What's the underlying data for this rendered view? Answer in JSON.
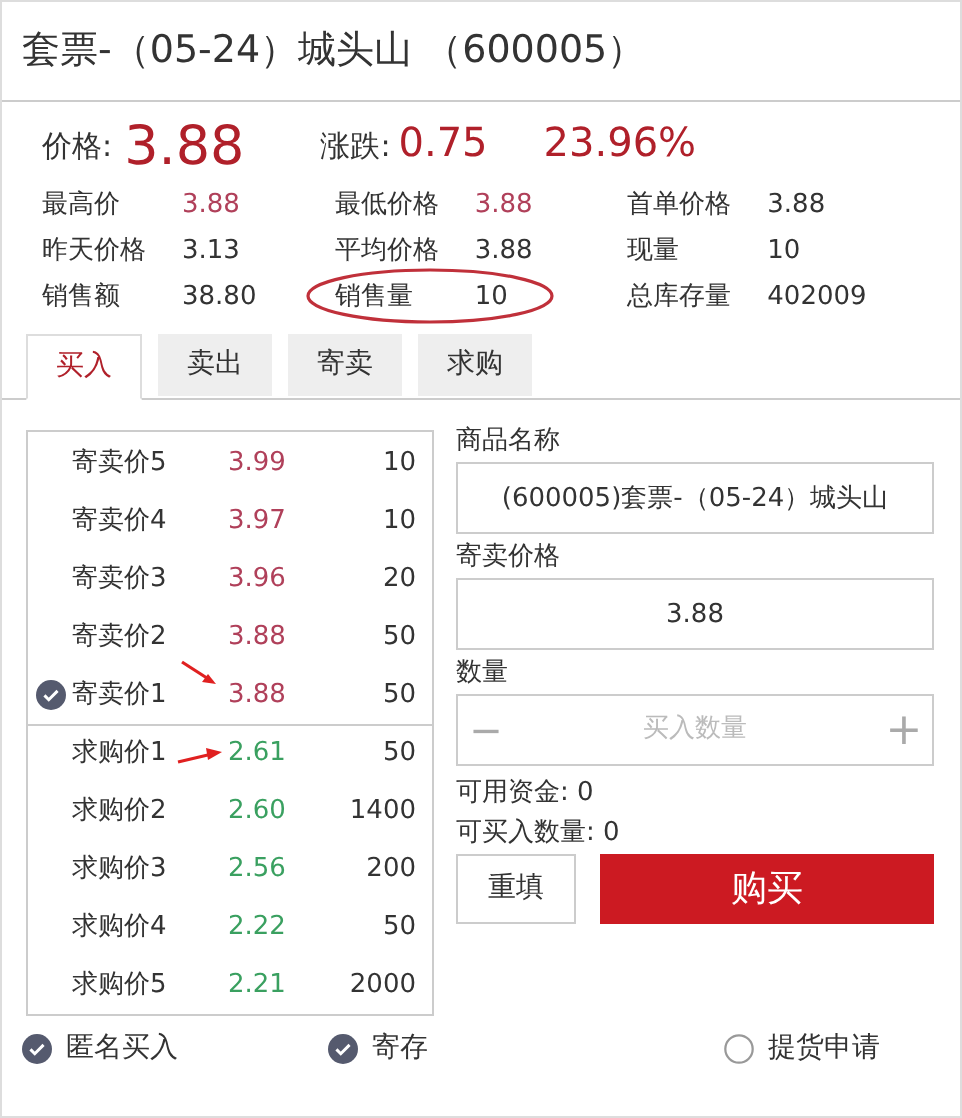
{
  "title": "套票-（05-24）城头山 （600005）",
  "price": {
    "label": "价格:",
    "value": "3.88"
  },
  "change": {
    "label": "涨跌:",
    "value": "0.75",
    "percent": "23.96%"
  },
  "stats": [
    {
      "label": "最高价",
      "value": "3.88",
      "kind": "price",
      "circled": false
    },
    {
      "label": "最低价格",
      "value": "3.88",
      "kind": "price",
      "circled": false
    },
    {
      "label": "首单价格",
      "value": "3.88",
      "kind": "plain",
      "circled": false
    },
    {
      "label": "昨天价格",
      "value": "3.13",
      "kind": "plain",
      "circled": false
    },
    {
      "label": "平均价格",
      "value": "3.88",
      "kind": "plain",
      "circled": false
    },
    {
      "label": "现量",
      "value": "10",
      "kind": "plain",
      "circled": false
    },
    {
      "label": "销售额",
      "value": "38.80",
      "kind": "plain",
      "circled": false
    },
    {
      "label": "销售量",
      "value": "10",
      "kind": "plain",
      "circled": true
    },
    {
      "label": "总库存量",
      "value": "402009",
      "kind": "plain",
      "circled": false
    }
  ],
  "tabs": [
    {
      "label": "买入",
      "selected": true
    },
    {
      "label": "卖出",
      "selected": false
    },
    {
      "label": "寄卖",
      "selected": false
    },
    {
      "label": "求购",
      "selected": false
    }
  ],
  "order_book": [
    {
      "label": "寄卖价5",
      "price": "3.99",
      "qty": "10",
      "kind": "sell",
      "selected": false,
      "arrow": false
    },
    {
      "label": "寄卖价4",
      "price": "3.97",
      "qty": "10",
      "kind": "sell",
      "selected": false,
      "arrow": false
    },
    {
      "label": "寄卖价3",
      "price": "3.96",
      "qty": "20",
      "kind": "sell",
      "selected": false,
      "arrow": false
    },
    {
      "label": "寄卖价2",
      "price": "3.88",
      "qty": "50",
      "kind": "sell",
      "selected": false,
      "arrow": false
    },
    {
      "label": "寄卖价1",
      "price": "3.88",
      "qty": "50",
      "kind": "sell",
      "selected": true,
      "arrow": true
    },
    {
      "label": "求购价1",
      "price": "2.61",
      "qty": "50",
      "kind": "buy",
      "selected": false,
      "arrow": true
    },
    {
      "label": "求购价2",
      "price": "2.60",
      "qty": "1400",
      "kind": "buy",
      "selected": false,
      "arrow": false
    },
    {
      "label": "求购价3",
      "price": "2.56",
      "qty": "200",
      "kind": "buy",
      "selected": false,
      "arrow": false
    },
    {
      "label": "求购价4",
      "price": "2.22",
      "qty": "50",
      "kind": "buy",
      "selected": false,
      "arrow": false
    },
    {
      "label": "求购价5",
      "price": "2.21",
      "qty": "2000",
      "kind": "buy",
      "selected": false,
      "arrow": false
    }
  ],
  "form": {
    "name_label": "商品名称",
    "name_value": "(600005)套票-（05-24）城头山",
    "price_label": "寄卖价格",
    "price_value": "3.88",
    "qty_label": "数量",
    "qty_placeholder": "买入数量",
    "minus": "−",
    "plus": "+",
    "funds": "可用资金: 0",
    "max_qty": "可买入数量: 0",
    "reset": "重填",
    "buy": "购买"
  },
  "options": [
    {
      "label": "匿名买入",
      "checked": true
    },
    {
      "label": "寄存",
      "checked": true
    },
    {
      "label": "提货申请",
      "checked": false
    }
  ]
}
